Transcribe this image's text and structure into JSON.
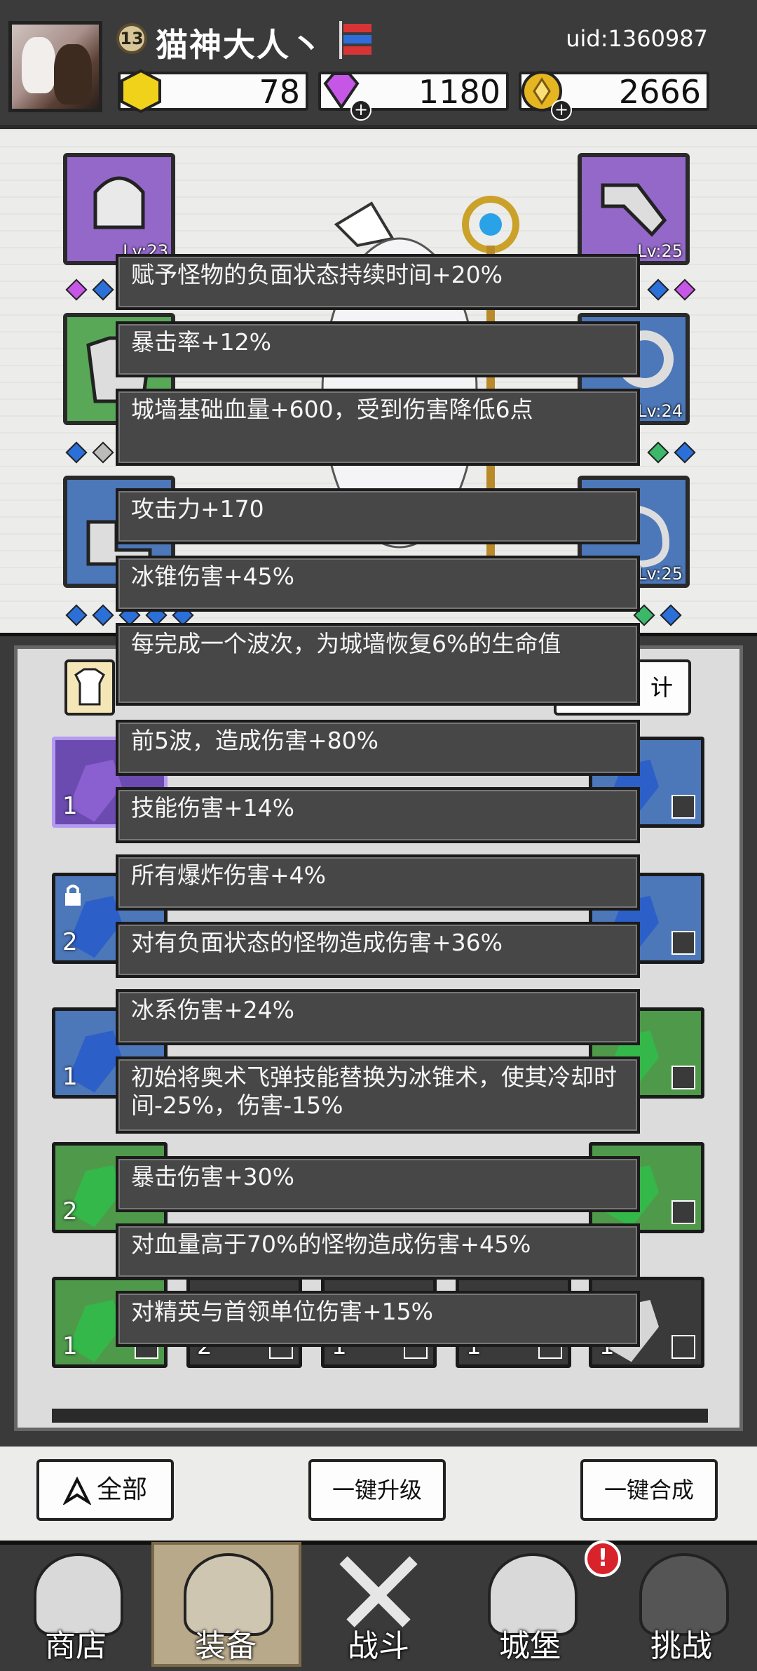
{
  "player": {
    "level": "13",
    "name": "猫神大人丶",
    "uid": "uid:1360987"
  },
  "currencies": [
    {
      "icon": "gold-hexagon-icon",
      "value": "78"
    },
    {
      "icon": "purple-diamond-icon",
      "value": "1180"
    },
    {
      "icon": "gold-coin-icon",
      "value": "2666"
    }
  ],
  "equipment": {
    "left": [
      {
        "icon": "helmet-icon",
        "level": "Lv:23"
      },
      {
        "icon": "armor-icon",
        "level": ""
      },
      {
        "icon": "boots-icon",
        "level": ""
      }
    ],
    "right": [
      {
        "icon": "gauntlet-icon",
        "level": "Lv:25"
      },
      {
        "icon": "ring-icon",
        "level": "Lv:24"
      },
      {
        "icon": "necklace-icon",
        "level": "Lv:25"
      }
    ]
  },
  "partial_label": "计",
  "inventory_counts": [
    "1",
    "2",
    "1",
    "2",
    "1"
  ],
  "bottom_row_counts": [
    "2",
    "1",
    "1",
    "1"
  ],
  "tooltip_lines": [
    "赋予怪物的负面状态持续时间+20%",
    "暴击率+12%",
    "城墙基础血量+600，受到伤害降低6点",
    "攻击力+170",
    "冰锥伤害+45%",
    "每完成一个波次，为城墙恢复6%的生命值",
    "前5波，造成伤害+80%",
    "技能伤害+14%",
    "所有爆炸伤害+4%",
    "对有负面状态的怪物造成伤害+36%",
    "冰系伤害+24%",
    "初始将奥术飞弹技能替换为冰锥术，使其冷却时间-25%，伤害-15%",
    "暴击伤害+30%",
    "对血量高于70%的怪物造成伤害+45%",
    "对精英与首领单位伤害+15%"
  ],
  "buttons": {
    "filter_all": "全部",
    "upgrade_all": "一键升级",
    "merge_all": "一键合成"
  },
  "nav": [
    {
      "label": "商店",
      "icon": "shop-icon"
    },
    {
      "label": "装备",
      "icon": "backpack-icon"
    },
    {
      "label": "战斗",
      "icon": "crossed-swords-icon"
    },
    {
      "label": "城堡",
      "icon": "castle-icon"
    },
    {
      "label": "挑战",
      "icon": "locked-challenge-icon"
    }
  ],
  "alert_badge": "!",
  "colors": {
    "rarity_purple": "#8a5fcf",
    "rarity_blue": "#4c77b8",
    "rarity_green": "#4f9a4a",
    "tooltip_bg": "#474747"
  }
}
